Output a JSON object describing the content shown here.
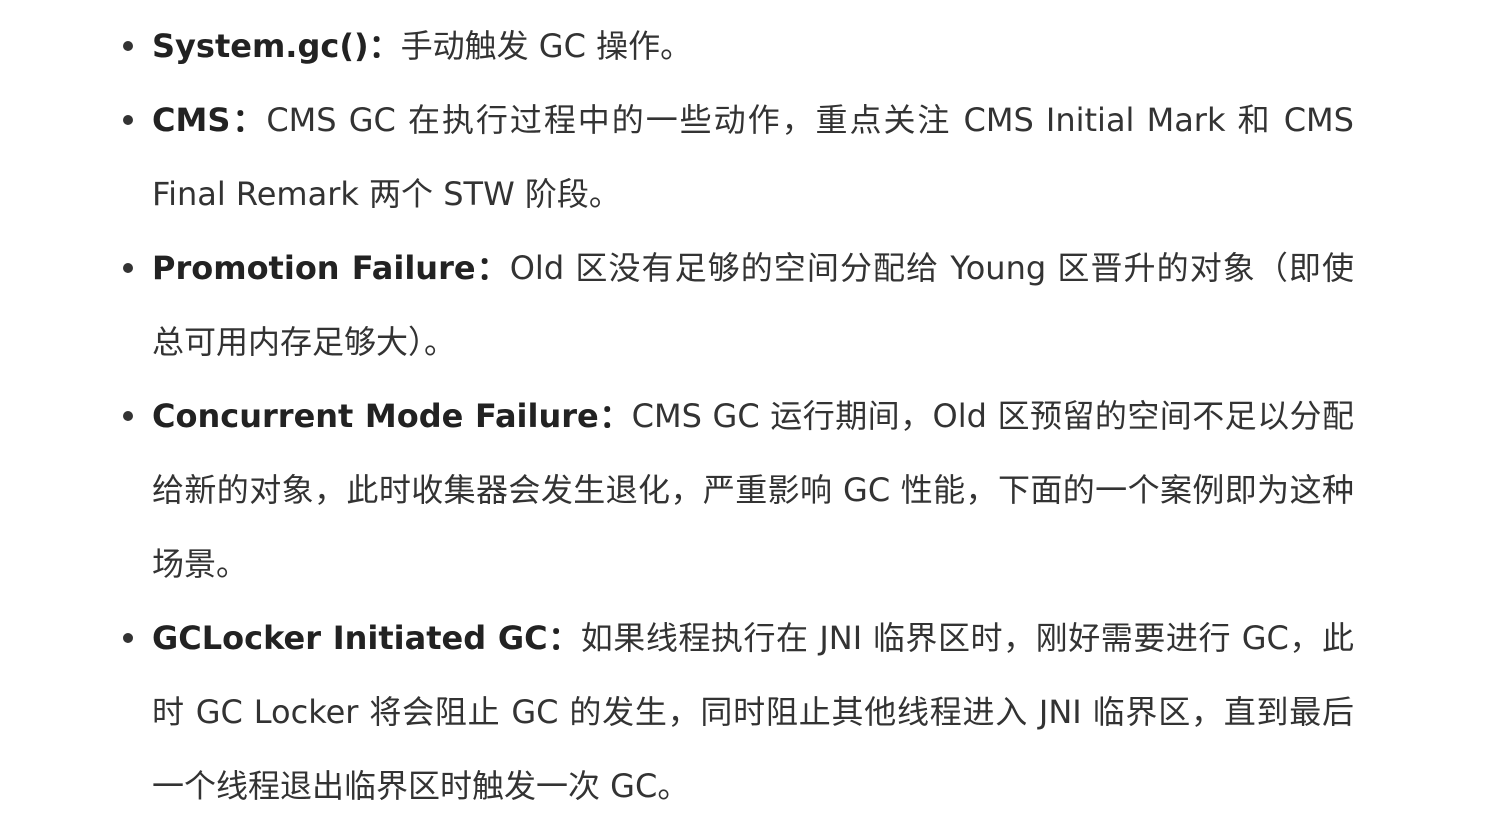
{
  "items": [
    {
      "term": "System.gc()",
      "colon": "：",
      "description": "手动触发 GC 操作。"
    },
    {
      "term": "CMS",
      "colon": "：",
      "description": "CMS GC 在执行过程中的一些动作，重点关注 CMS Initial Mark 和 CMS Final Remark 两个 STW 阶段。"
    },
    {
      "term": "Promotion Failure",
      "colon": "：",
      "description": "Old 区没有足够的空间分配给 Young 区晋升的对象（即使总可用内存足够大）。"
    },
    {
      "term": "Concurrent Mode Failure",
      "colon": "：",
      "description": "CMS GC 运行期间，Old 区预留的空间不足以分配给新的对象，此时收集器会发生退化，严重影响 GC 性能，下面的一个案例即为这种场景。"
    },
    {
      "term": "GCLocker Initiated GC",
      "colon": "：",
      "description": "如果线程执行在 JNI 临界区时，刚好需要进行 GC，此时 GC Locker 将会阻止 GC 的发生，同时阻止其他线程进入 JNI 临界区，直到最后一个线程退出临界区时触发一次 GC。"
    }
  ]
}
